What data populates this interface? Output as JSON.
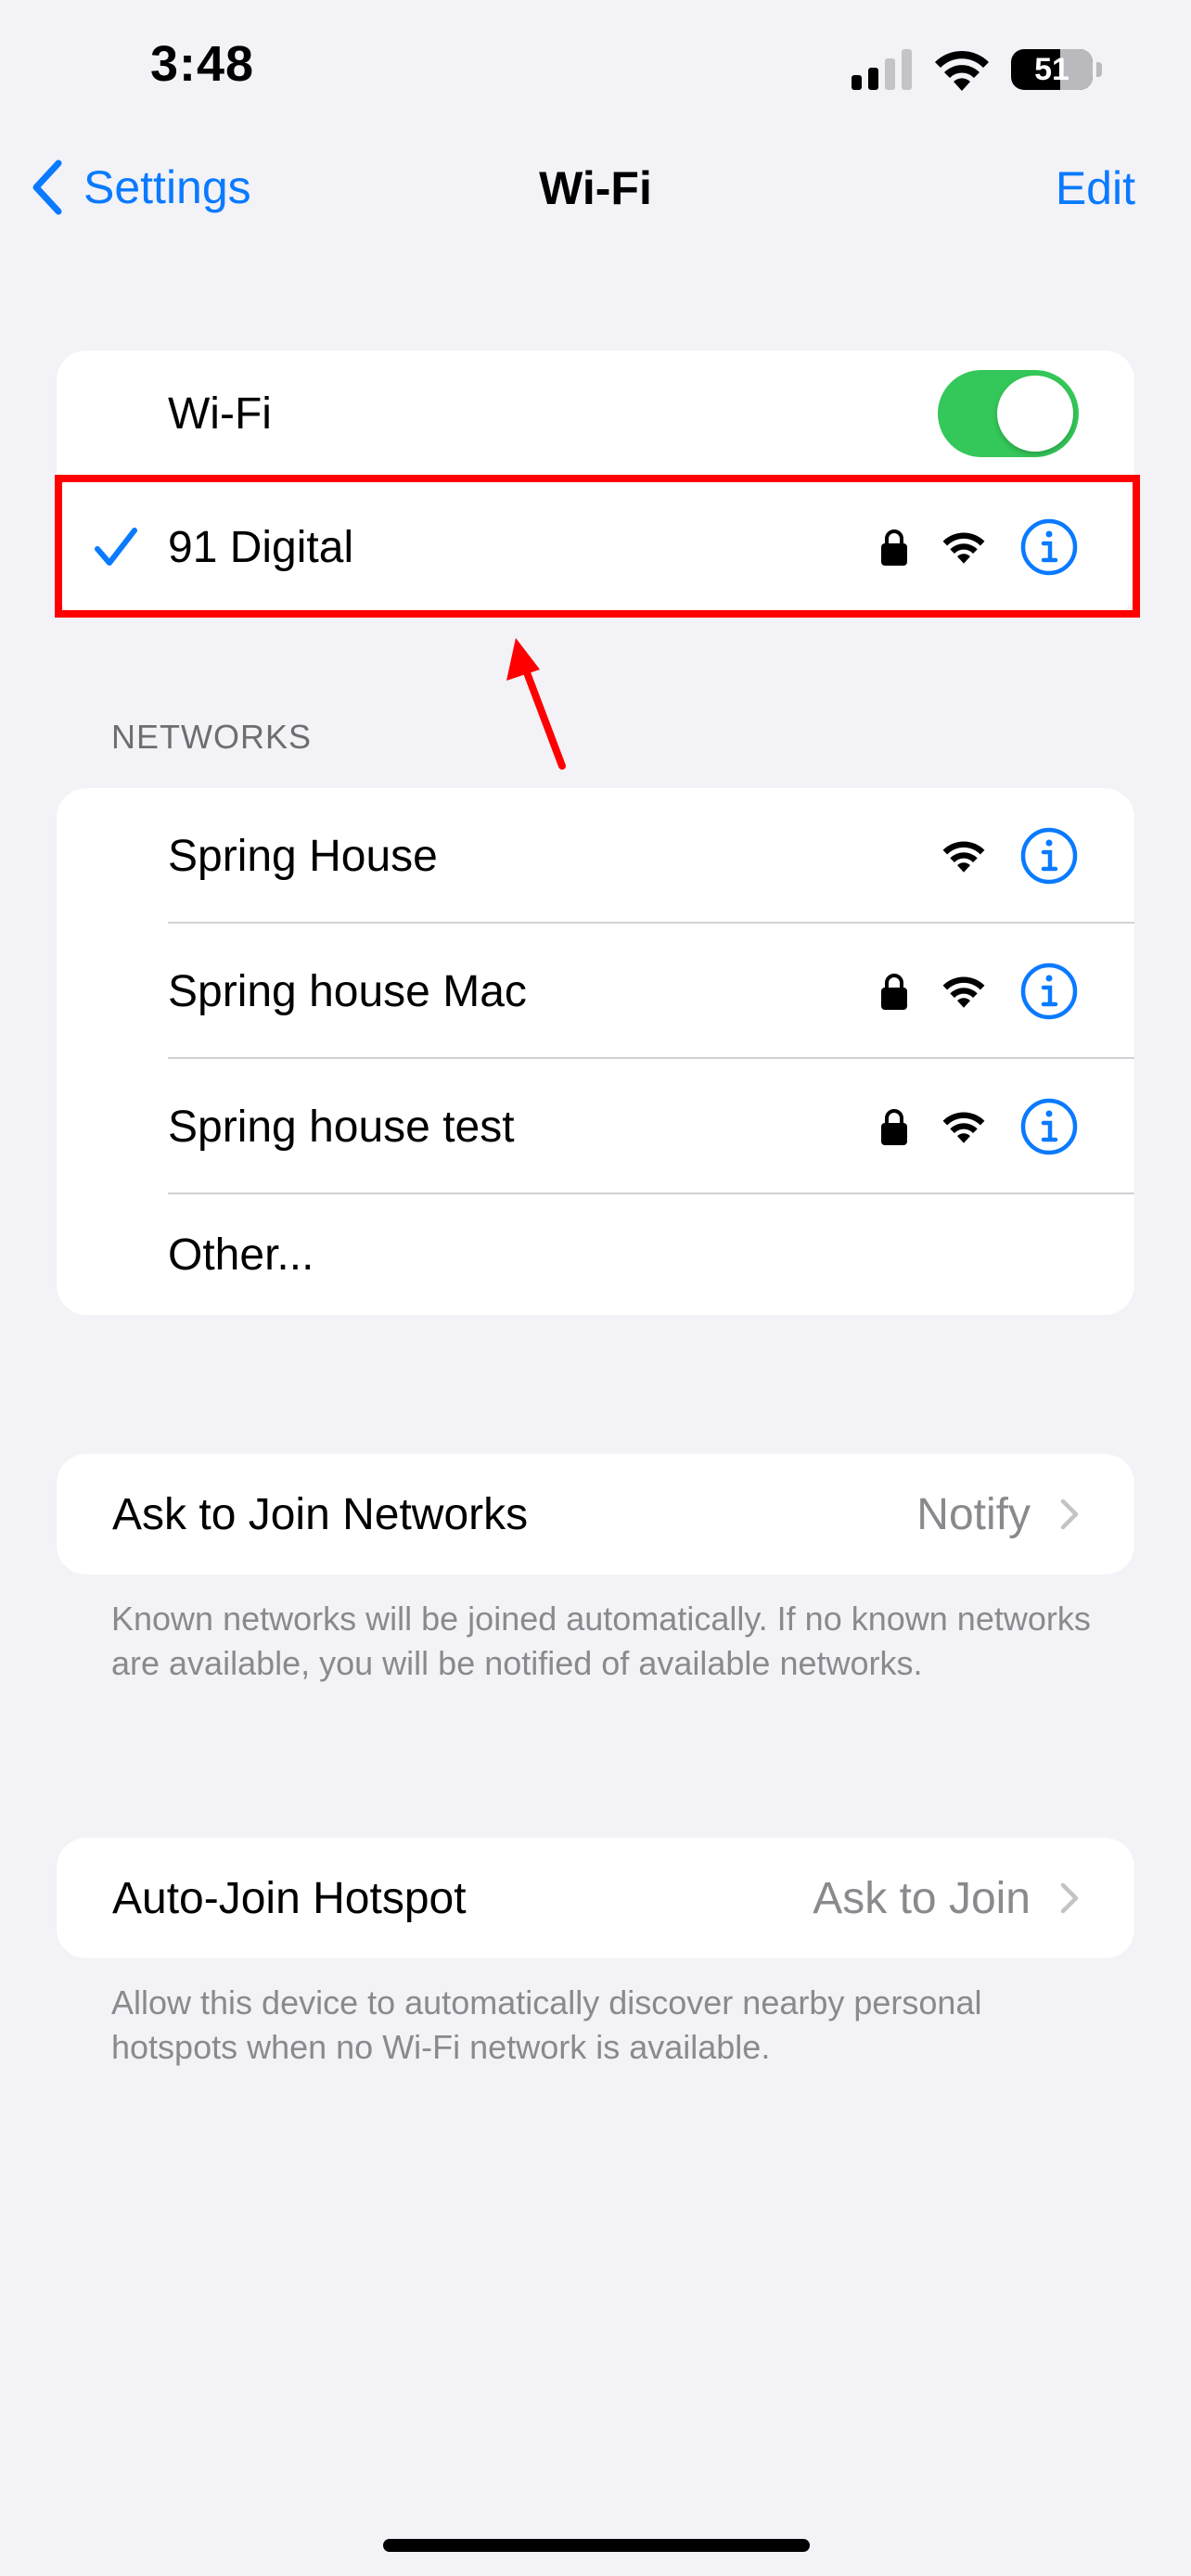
{
  "status_bar": {
    "time": "3:48",
    "battery": "51"
  },
  "nav": {
    "back_label": "Settings",
    "title": "Wi-Fi",
    "edit_label": "Edit"
  },
  "wifi": {
    "toggle_label": "Wi-Fi",
    "toggle_on": true,
    "connected_network": "91 Digital",
    "connected_locked": true
  },
  "networks": {
    "header": "NETWORKS",
    "items": [
      {
        "name": "Spring House",
        "locked": false
      },
      {
        "name": "Spring house Mac",
        "locked": true
      },
      {
        "name": "Spring house test",
        "locked": true
      }
    ],
    "other_label": "Other..."
  },
  "ask_to_join": {
    "label": "Ask to Join Networks",
    "value": "Notify",
    "footnote": "Known networks will be joined automatically. If no known networks are available, you will be notified of available networks."
  },
  "auto_join": {
    "label": "Auto-Join Hotspot",
    "value": "Ask to Join",
    "footnote": "Allow this device to automatically discover nearby personal hotspots when no Wi-Fi network is available."
  },
  "colors": {
    "accent": "#0a7aff",
    "toggle_on": "#34c759",
    "annotation": "#ff0000",
    "background": "#f2f2f7"
  },
  "icons": [
    "chevron-left-icon",
    "checkmark-icon",
    "lock-icon",
    "wifi-icon",
    "info-icon",
    "chevron-right-icon",
    "cellular-signal-icon",
    "battery-icon"
  ]
}
